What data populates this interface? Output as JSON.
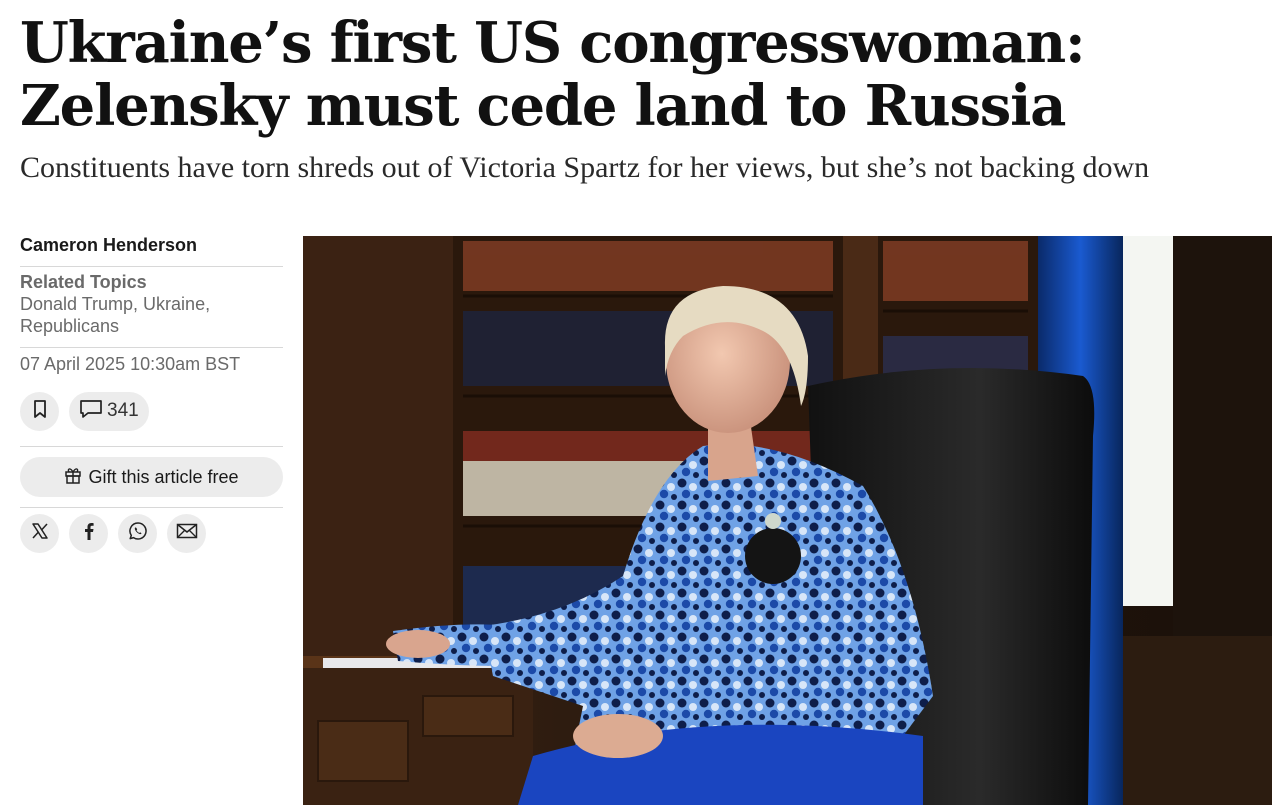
{
  "article": {
    "headline": "Ukraine’s first US congresswoman: Zelensky must cede land to Russia",
    "standfirst": "Constituents have torn shreds out of Victoria Spartz for her views, but she’s not backing down",
    "author": "Cameron Henderson",
    "related_topics_label": "Related Topics",
    "related_topics": "Donald Trump, Ukraine, Republicans",
    "date": "07 April 2025 10:30am BST"
  },
  "actions": {
    "bookmark_icon": "bookmark-icon",
    "comment_icon": "comment-icon",
    "comment_count": "341",
    "gift_icon": "gift-icon",
    "gift_label": "Gift this article free"
  },
  "share": [
    {
      "icon": "x-icon"
    },
    {
      "icon": "facebook-icon"
    },
    {
      "icon": "whatsapp-icon"
    },
    {
      "icon": "email-icon"
    }
  ],
  "colors": {
    "button_bg": "#ececec",
    "meta_text": "#6a6a6a",
    "headline_text": "#111111"
  }
}
